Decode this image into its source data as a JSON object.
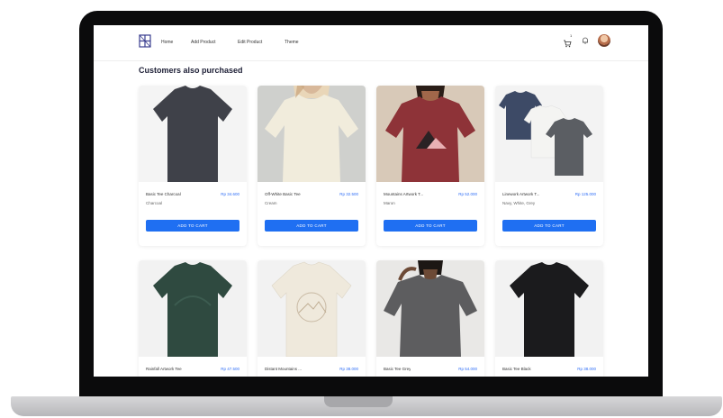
{
  "nav": {
    "links": [
      "Home",
      "Add Product",
      "Edit Product",
      "Theme"
    ],
    "cart_count": "1"
  },
  "section_title": "Customers also purchased",
  "products": [
    {
      "name": "Basic Tee Charcoal",
      "price": "Rp 34.600",
      "color": "Charcoal",
      "button": "ADD TO CART"
    },
    {
      "name": "Off-White Basic Tee",
      "price": "Rp 32.500",
      "color": "Cream",
      "button": "ADD TO CART"
    },
    {
      "name": "Mountains Artwork T...",
      "price": "Rp 52.000",
      "color": "Maron",
      "button": "ADD TO CART"
    },
    {
      "name": "Linework Artwork T...",
      "price": "Rp 125.000",
      "color": "Navy, White, Grey",
      "button": "ADD TO CART"
    },
    {
      "name": "Rainfall Artwork Tee",
      "price": "Rp 47.500",
      "color": "",
      "button": ""
    },
    {
      "name": "Distant Mountains ...",
      "price": "Rp 38.000",
      "color": "",
      "button": ""
    },
    {
      "name": "Basic Tee Grey",
      "price": "Rp 54.000",
      "color": "",
      "button": ""
    },
    {
      "name": "Basic Tee Black",
      "price": "Rp 38.000",
      "color": "",
      "button": ""
    }
  ],
  "colors": {
    "accent": "#1f6ff2",
    "price": "#2f6ef6",
    "title": "#1d1f36"
  }
}
